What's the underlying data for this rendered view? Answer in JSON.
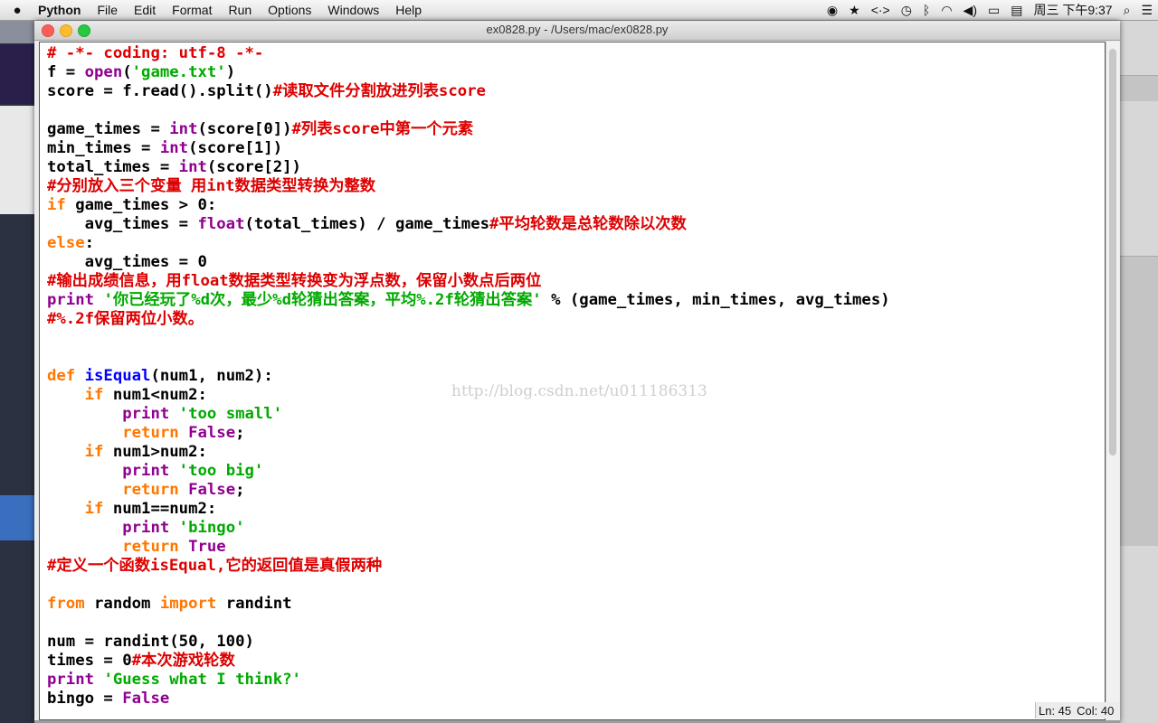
{
  "menubar": {
    "apple_icon": "apple-icon",
    "app_name": "Python",
    "menus": [
      "File",
      "Edit",
      "Format",
      "Run",
      "Options",
      "Windows",
      "Help"
    ],
    "clock": "周三 下午9:37"
  },
  "window": {
    "title": "ex0828.py - /Users/mac/ex0828.py"
  },
  "status": {
    "line": "Ln: 45",
    "col": "Col: 40"
  },
  "watermark": "http://blog.csdn.net/u011186313",
  "colors": {
    "keyword": "#ff7700",
    "builtin": "#900090",
    "string": "#00aa00",
    "comment": "#dd0000",
    "defname": "#0000ff"
  },
  "code_lines": [
    [
      {
        "t": "# -*- coding: utf-8 -*-",
        "c": "cm"
      }
    ],
    [
      {
        "t": "f = "
      },
      {
        "t": "open",
        "c": "bi"
      },
      {
        "t": "("
      },
      {
        "t": "'game.txt'",
        "c": "st"
      },
      {
        "t": ")"
      }
    ],
    [
      {
        "t": "score = f.read().split()"
      },
      {
        "t": "#读取文件分割放进列表score",
        "c": "cm"
      }
    ],
    [],
    [
      {
        "t": "game_times = "
      },
      {
        "t": "int",
        "c": "bi"
      },
      {
        "t": "(score[0])"
      },
      {
        "t": "#列表score中第一个元素",
        "c": "cm"
      }
    ],
    [
      {
        "t": "min_times = "
      },
      {
        "t": "int",
        "c": "bi"
      },
      {
        "t": "(score[1])"
      }
    ],
    [
      {
        "t": "total_times = "
      },
      {
        "t": "int",
        "c": "bi"
      },
      {
        "t": "(score[2])"
      }
    ],
    [
      {
        "t": "#分别放入三个变量 用int数据类型转换为整数",
        "c": "cm"
      }
    ],
    [
      {
        "t": "if",
        "c": "kw"
      },
      {
        "t": " game_times > 0:"
      }
    ],
    [
      {
        "t": "    avg_times = "
      },
      {
        "t": "float",
        "c": "bi"
      },
      {
        "t": "(total_times) / game_times"
      },
      {
        "t": "#平均轮数是总轮数除以次数",
        "c": "cm"
      }
    ],
    [
      {
        "t": "else",
        "c": "kw"
      },
      {
        "t": ":"
      }
    ],
    [
      {
        "t": "    avg_times = 0"
      }
    ],
    [
      {
        "t": "#输出成绩信息，用float数据类型转换变为浮点数，保留小数点后两位",
        "c": "cm"
      }
    ],
    [
      {
        "t": "print",
        "c": "bi"
      },
      {
        "t": " "
      },
      {
        "t": "'你已经玩了%d次，最少%d轮猜出答案，平均%.2f轮猜出答案'",
        "c": "st"
      },
      {
        "t": " % (game_times, min_times, avg_times)"
      }
    ],
    [
      {
        "t": "#%.2f保留两位小数。",
        "c": "cm"
      }
    ],
    [],
    [],
    [
      {
        "t": "def",
        "c": "kw"
      },
      {
        "t": " "
      },
      {
        "t": "isEqual",
        "c": "df"
      },
      {
        "t": "(num1, num2):"
      }
    ],
    [
      {
        "t": "    "
      },
      {
        "t": "if",
        "c": "kw"
      },
      {
        "t": " num1<num2:"
      }
    ],
    [
      {
        "t": "        "
      },
      {
        "t": "print",
        "c": "bi"
      },
      {
        "t": " "
      },
      {
        "t": "'too small'",
        "c": "st"
      }
    ],
    [
      {
        "t": "        "
      },
      {
        "t": "return",
        "c": "kw"
      },
      {
        "t": " "
      },
      {
        "t": "False",
        "c": "bi"
      },
      {
        "t": ";"
      }
    ],
    [
      {
        "t": "    "
      },
      {
        "t": "if",
        "c": "kw"
      },
      {
        "t": " num1>num2:"
      }
    ],
    [
      {
        "t": "        "
      },
      {
        "t": "print",
        "c": "bi"
      },
      {
        "t": " "
      },
      {
        "t": "'too big'",
        "c": "st"
      }
    ],
    [
      {
        "t": "        "
      },
      {
        "t": "return",
        "c": "kw"
      },
      {
        "t": " "
      },
      {
        "t": "False",
        "c": "bi"
      },
      {
        "t": ";"
      }
    ],
    [
      {
        "t": "    "
      },
      {
        "t": "if",
        "c": "kw"
      },
      {
        "t": " num1==num2:"
      }
    ],
    [
      {
        "t": "        "
      },
      {
        "t": "print",
        "c": "bi"
      },
      {
        "t": " "
      },
      {
        "t": "'bingo'",
        "c": "st"
      }
    ],
    [
      {
        "t": "        "
      },
      {
        "t": "return",
        "c": "kw"
      },
      {
        "t": " "
      },
      {
        "t": "True",
        "c": "bi"
      }
    ],
    [
      {
        "t": "#定义一个函数isEqual,它的返回值是真假两种",
        "c": "cm"
      }
    ],
    [],
    [
      {
        "t": "from",
        "c": "kw"
      },
      {
        "t": " random "
      },
      {
        "t": "import",
        "c": "kw"
      },
      {
        "t": " randint"
      }
    ],
    [],
    [
      {
        "t": "num = randint(50, 100)"
      }
    ],
    [
      {
        "t": "times = 0"
      },
      {
        "t": "#本次游戏轮数",
        "c": "cm"
      }
    ],
    [
      {
        "t": "print",
        "c": "bi"
      },
      {
        "t": " "
      },
      {
        "t": "'Guess what I think?'",
        "c": "st"
      }
    ],
    [
      {
        "t": "bingo = "
      },
      {
        "t": "False",
        "c": "bi"
      }
    ]
  ]
}
